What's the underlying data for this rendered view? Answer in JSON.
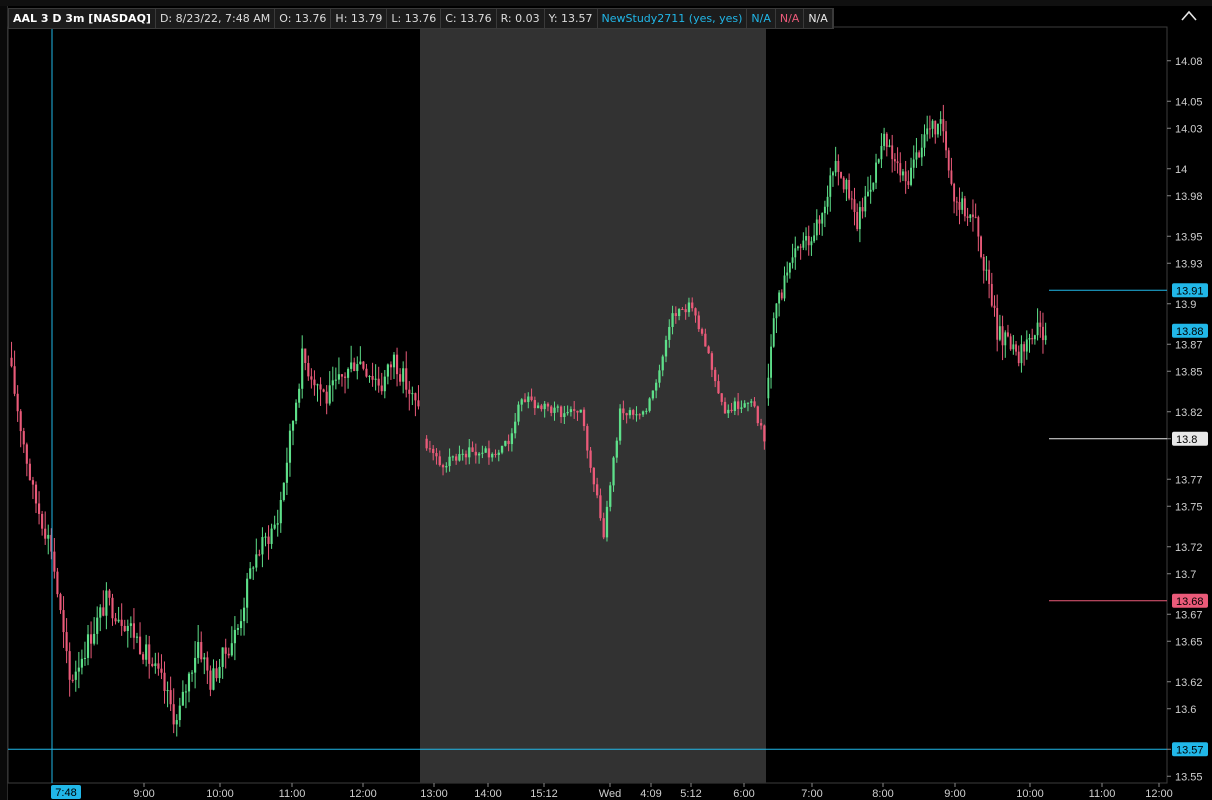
{
  "header": {
    "symbol": "AAL 3 D 3m [NASDAQ]",
    "date": "D: 8/23/22, 7:48 AM",
    "open": "O: 13.76",
    "high": "H: 13.79",
    "low": "L: 13.76",
    "close": "C: 13.76",
    "range": "R: 0.03",
    "y": "Y: 13.57",
    "study": "NewStudy2711 (yes, yes)",
    "na1": "N/A",
    "na2": "N/A",
    "na3": "N/A"
  },
  "colors": {
    "up": "#5ee08a",
    "down": "#ea5a79",
    "extended_shade": "#323232",
    "cursor": "#21b7e8",
    "cyan_level": "#21b7e8",
    "white_level": "#e8e8e8",
    "red_level": "#ea5a79"
  },
  "chart_data": {
    "type": "candlestick",
    "ylim": [
      13.545,
      14.105
    ],
    "y_ticks": [
      "14.08",
      "14.05",
      "14.03",
      "14",
      "13.98",
      "13.95",
      "13.93",
      "13.9",
      "13.87",
      "13.85",
      "13.82",
      "13.8",
      "13.77",
      "13.75",
      "13.72",
      "13.7",
      "13.67",
      "13.65",
      "13.62",
      "13.6",
      "13.57",
      "13.55"
    ],
    "x_ticks": [
      "9:00",
      "10:00",
      "11:00",
      "12:00",
      "13:00",
      "14:00",
      "15:12",
      "Wed",
      "4:09",
      "5:12",
      "6:00",
      "7:00",
      "8:00",
      "9:00",
      "10:00",
      "11:00",
      "12:00"
    ],
    "shaded_session": {
      "from": "13:00",
      "to": "6:30"
    },
    "cursor": {
      "time_label": "7:48",
      "price_label": "13.57",
      "price": 13.57
    },
    "levels": [
      {
        "label": "13.91",
        "price": 13.91,
        "style": "cyan"
      },
      {
        "label": "13.88",
        "price": 13.88,
        "style": "cyan"
      },
      {
        "label": "13.8",
        "price": 13.8,
        "style": "white"
      },
      {
        "label": "13.68",
        "price": 13.68,
        "style": "red"
      }
    ],
    "segments": [
      {
        "price_path": [
          [
            0,
            13.86
          ],
          [
            8,
            13.76
          ],
          [
            14,
            13.72
          ],
          [
            20,
            13.62
          ],
          [
            32,
            13.68
          ],
          [
            40,
            13.66
          ],
          [
            50,
            13.62
          ],
          [
            55,
            13.59
          ],
          [
            62,
            13.65
          ],
          [
            66,
            13.62
          ],
          [
            75,
            13.66
          ],
          [
            80,
            13.71
          ],
          [
            88,
            13.74
          ],
          [
            96,
            13.86
          ],
          [
            104,
            13.83
          ],
          [
            114,
            13.86
          ],
          [
            122,
            13.84
          ],
          [
            126,
            13.86
          ],
          [
            134,
            13.82
          ]
        ],
        "volatility": 0.016
      },
      {
        "price_path": [
          [
            0,
            13.8
          ],
          [
            5,
            13.78
          ],
          [
            12,
            13.79
          ],
          [
            22,
            13.79
          ],
          [
            26,
            13.8
          ],
          [
            30,
            13.83
          ],
          [
            40,
            13.82
          ],
          [
            48,
            13.82
          ],
          [
            55,
            13.73
          ],
          [
            60,
            13.82
          ],
          [
            68,
            13.82
          ],
          [
            72,
            13.85
          ],
          [
            76,
            13.89
          ],
          [
            82,
            13.9
          ],
          [
            86,
            13.87
          ],
          [
            92,
            13.82
          ],
          [
            100,
            13.83
          ],
          [
            104,
            13.8
          ]
        ],
        "volatility": 0.008
      },
      {
        "price_path": [
          [
            0,
            13.83
          ],
          [
            4,
            13.9
          ],
          [
            12,
            13.94
          ],
          [
            20,
            13.96
          ],
          [
            26,
            14.01
          ],
          [
            34,
            13.96
          ],
          [
            44,
            14.02
          ],
          [
            52,
            13.99
          ],
          [
            60,
            14.03
          ],
          [
            66,
            14.03
          ],
          [
            70,
            13.98
          ],
          [
            78,
            13.96
          ],
          [
            86,
            13.88
          ],
          [
            94,
            13.86
          ],
          [
            100,
            13.88
          ],
          [
            104,
            13.88
          ]
        ],
        "volatility": 0.014
      }
    ]
  }
}
